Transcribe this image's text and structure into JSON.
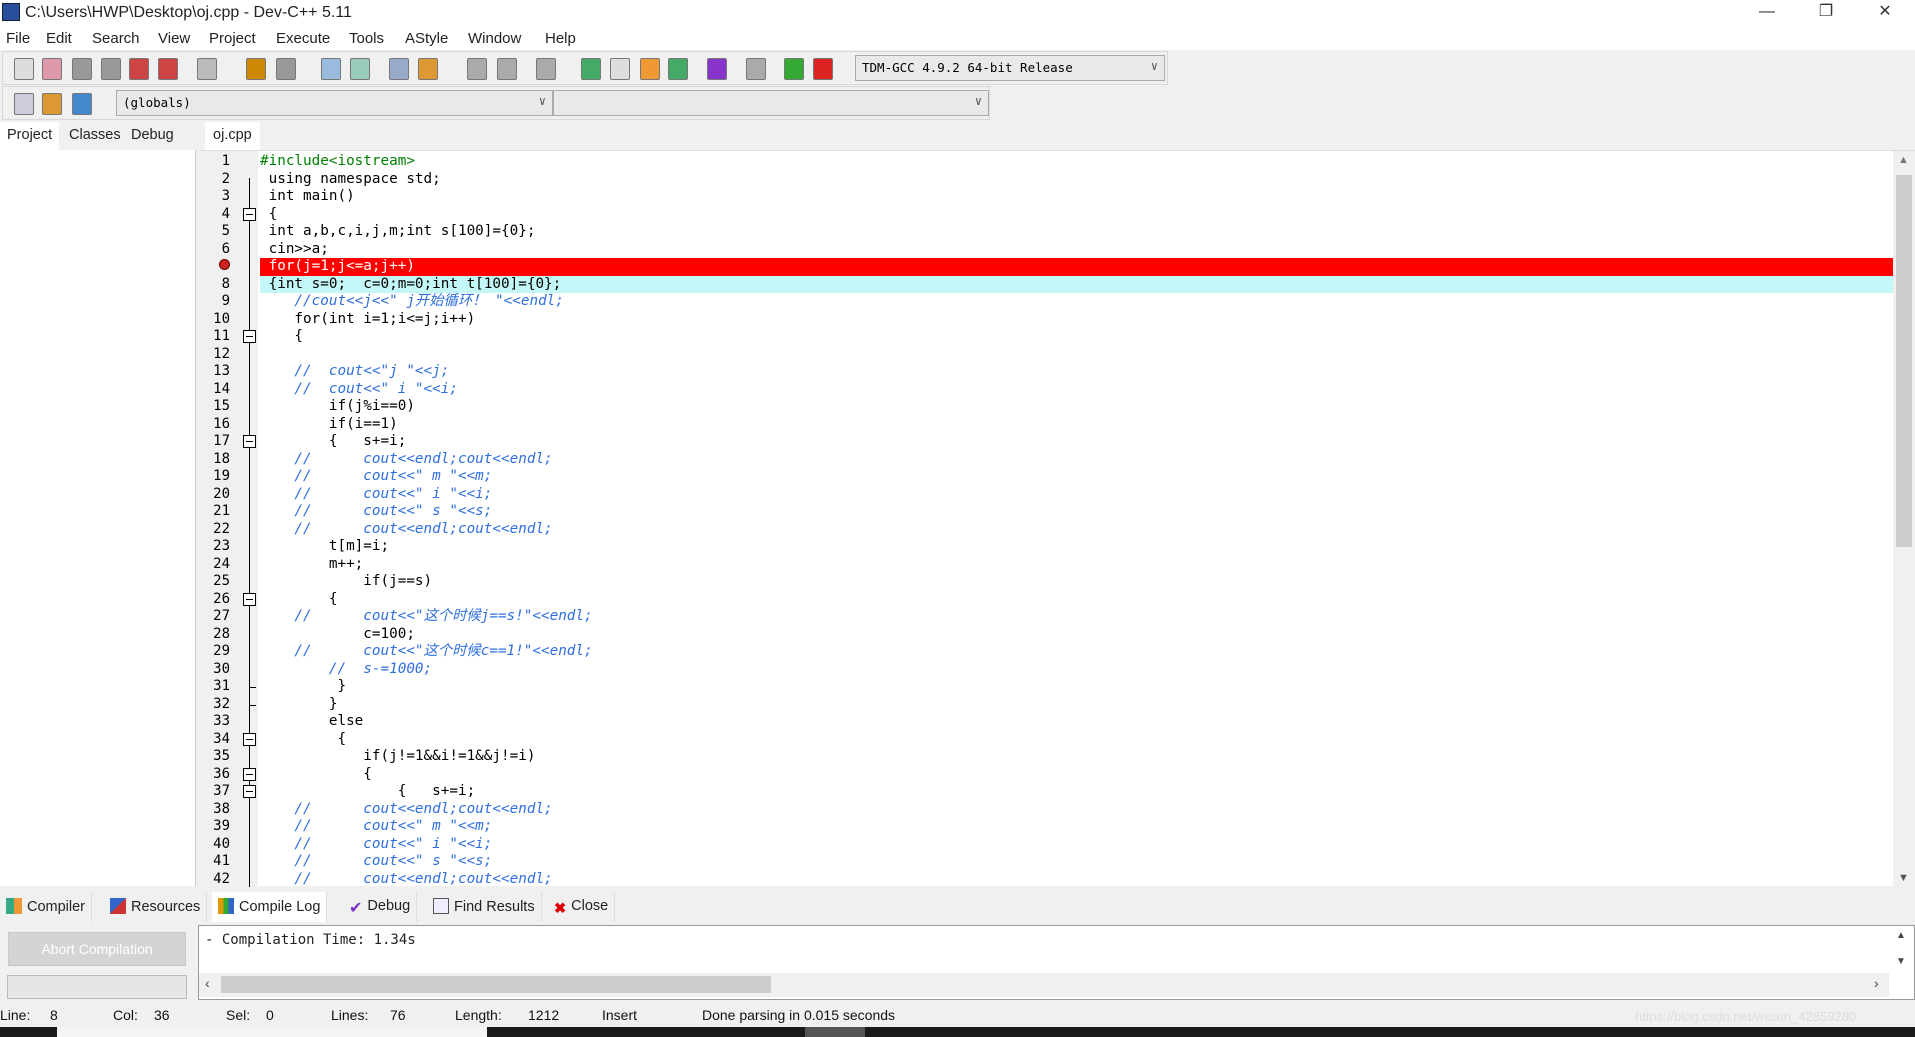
{
  "window": {
    "title": "C:\\Users\\HWP\\Desktop\\oj.cpp - Dev-C++ 5.11",
    "minimize": "—",
    "restore": "❐",
    "close": "✕"
  },
  "menu": [
    "File",
    "Edit",
    "Search",
    "View",
    "Project",
    "Execute",
    "Tools",
    "AStyle",
    "Window",
    "Help"
  ],
  "toolbar": {
    "icons": [
      "new-file",
      "open-file",
      "save",
      "save-all",
      "close-file",
      "close-all",
      "print",
      "undo",
      "redo",
      "find",
      "replace",
      "indent",
      "unindent",
      "goto-back",
      "goto-forward",
      "bookmark",
      "compile",
      "run",
      "compile-run",
      "rebuild",
      "syntax-check",
      "stop",
      "profile",
      "delete-profile"
    ],
    "compiler": "TDM-GCC 4.9.2 64-bit Release",
    "icons2": [
      "insert",
      "toggle-breakpoint",
      "goto-bookmark"
    ],
    "scope": "(globals)",
    "member": ""
  },
  "left_tabs": [
    "Project",
    "Classes",
    "Debug"
  ],
  "editor_tab": "oj.cpp",
  "code": [
    "#include<iostream>",
    " using namespace std;",
    " int main()",
    " {",
    " int a,b,c,i,j,m;int s[100]={0};",
    " cin>>a;",
    " for(j=1;j<=a;j++)",
    " {int s=0;  c=0;m=0;int t[100]={0};",
    "    //cout<<j<<\" j开始循环！ \"<<endl;",
    "    for(int i=1;i<=j;i++)",
    "    {",
    "",
    "    //  cout<<\"j \"<<j;",
    "    //  cout<<\" i \"<<i;",
    "        if(j%i==0)",
    "        if(i==1)",
    "        {   s+=i;",
    "    //      cout<<endl;cout<<endl;",
    "    //      cout<<\" m \"<<m;",
    "    //      cout<<\" i \"<<i;",
    "    //      cout<<\" s \"<<s;",
    "    //      cout<<endl;cout<<endl;",
    "        t[m]=i;",
    "        m++;",
    "            if(j==s)",
    "        {",
    "    //      cout<<\"这个时候j==s!\"<<endl;",
    "            c=100;",
    "    //      cout<<\"这个时候c==1!\"<<endl;",
    "        //  s-=1000;",
    "         }",
    "        }",
    "        else",
    "         {",
    "            if(j!=1&&i!=1&&j!=i)",
    "            {",
    "                {   s+=i;",
    "    //      cout<<endl;cout<<endl;",
    "    //      cout<<\" m \"<<m;",
    "    //      cout<<\" i \"<<i;",
    "    //      cout<<\" s \"<<s;",
    "    //      cout<<endl;cout<<endl;"
  ],
  "error_line": 7,
  "current_line": 8,
  "bottom_tabs": [
    "Compiler",
    "Resources",
    "Compile Log",
    "Debug",
    "Find Results",
    "Close"
  ],
  "abort_button": "Abort Compilation",
  "log": "- Compilation Time: 1.34s",
  "status": {
    "line_label": "Line:",
    "line": "8",
    "col_label": "Col:",
    "col": "36",
    "sel_label": "Sel:",
    "sel": "0",
    "lines_label": "Lines:",
    "lines": "76",
    "length_label": "Length:",
    "length": "1212",
    "mode": "Insert",
    "message": "Done parsing in 0.015 seconds"
  },
  "watermark": "https://blog.csdn.net/weixin_42859280",
  "colors": {
    "error_line": "#ff0000",
    "current_line": "#c4f7f7",
    "comment": "#2f6fe0",
    "symbol": "#ff0000",
    "number": "#8a00c8",
    "preprocessor": "#008000"
  }
}
